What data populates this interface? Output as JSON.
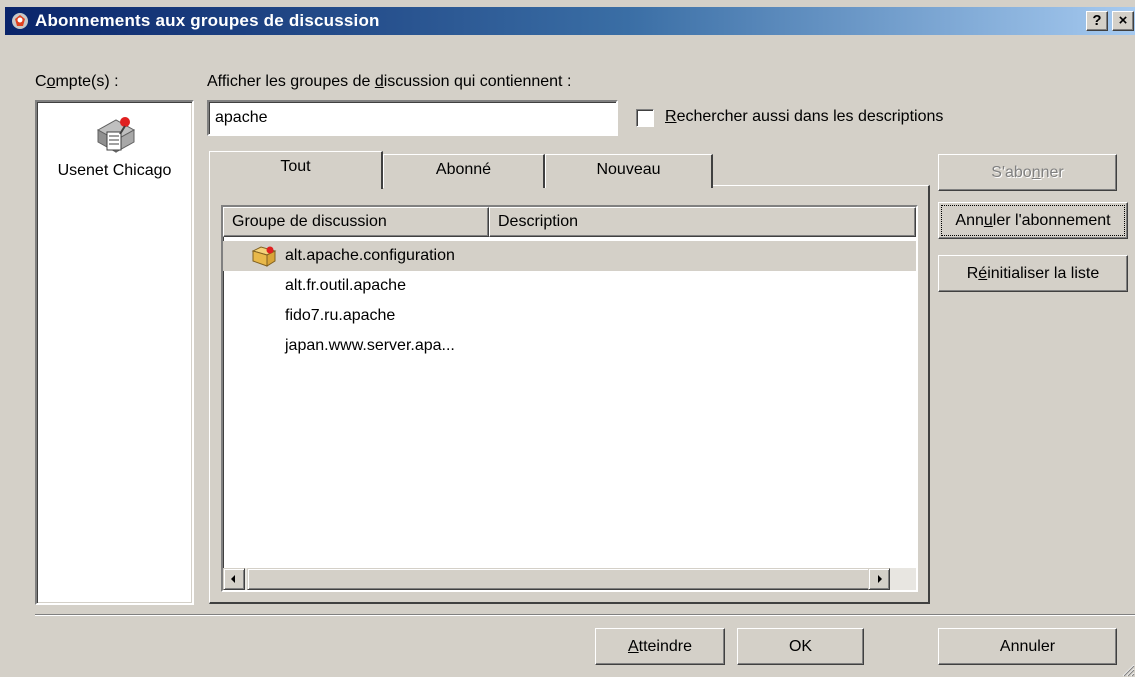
{
  "window": {
    "title": "Abonnements aux groupes de discussion",
    "help_label": "?",
    "close_label": "×"
  },
  "accounts": {
    "label": "Compte(s) :",
    "label_pre": "C",
    "label_mnemonic": "o",
    "label_post": "mpte(s) :",
    "items": [
      {
        "label": "Usenet Chicago",
        "icon": "news-server-icon"
      }
    ]
  },
  "search": {
    "label_pre": "Afficher les groupes de ",
    "label_mnemonic": "d",
    "label_post": "iscussion qui contiennent :",
    "value": "apache"
  },
  "descriptions_checkbox": {
    "checked": false,
    "label_mnemonic": "R",
    "label_post": "echercher aussi dans les descriptions"
  },
  "tabs": [
    {
      "label": "Tout",
      "active": true
    },
    {
      "label": "Abonné",
      "active": false
    },
    {
      "label": "Nouveau",
      "active": false
    }
  ],
  "list": {
    "columns": [
      "Groupe de discussion",
      "Description"
    ],
    "rows": [
      {
        "name": "alt.apache.configuration",
        "description": "",
        "subscribed": true,
        "selected": true
      },
      {
        "name": "alt.fr.outil.apache",
        "description": "",
        "subscribed": false,
        "selected": false
      },
      {
        "name": "fido7.ru.apache",
        "description": "",
        "subscribed": false,
        "selected": false
      },
      {
        "name": "japan.www.server.apa...",
        "description": "",
        "subscribed": false,
        "selected": false
      }
    ]
  },
  "side_buttons": {
    "subscribe_pre": "S'abo",
    "subscribe_mnemonic": "n",
    "subscribe_post": "ner",
    "unsubscribe_pre": "Ann",
    "unsubscribe_mnemonic": "u",
    "unsubscribe_post": "ler l'abonnement",
    "reset_pre": "R",
    "reset_mnemonic": "é",
    "reset_post": "initialiser la liste"
  },
  "footer_buttons": {
    "goto_mnemonic": "A",
    "goto_post": "tteindre",
    "ok_label": "OK",
    "cancel_label": "Annuler"
  },
  "colors": {
    "dialog_face": "#d4d0c8",
    "title_gradient_start": "#0a246a",
    "title_gradient_end": "#a6caf0",
    "selection": "#d4d0c8"
  }
}
